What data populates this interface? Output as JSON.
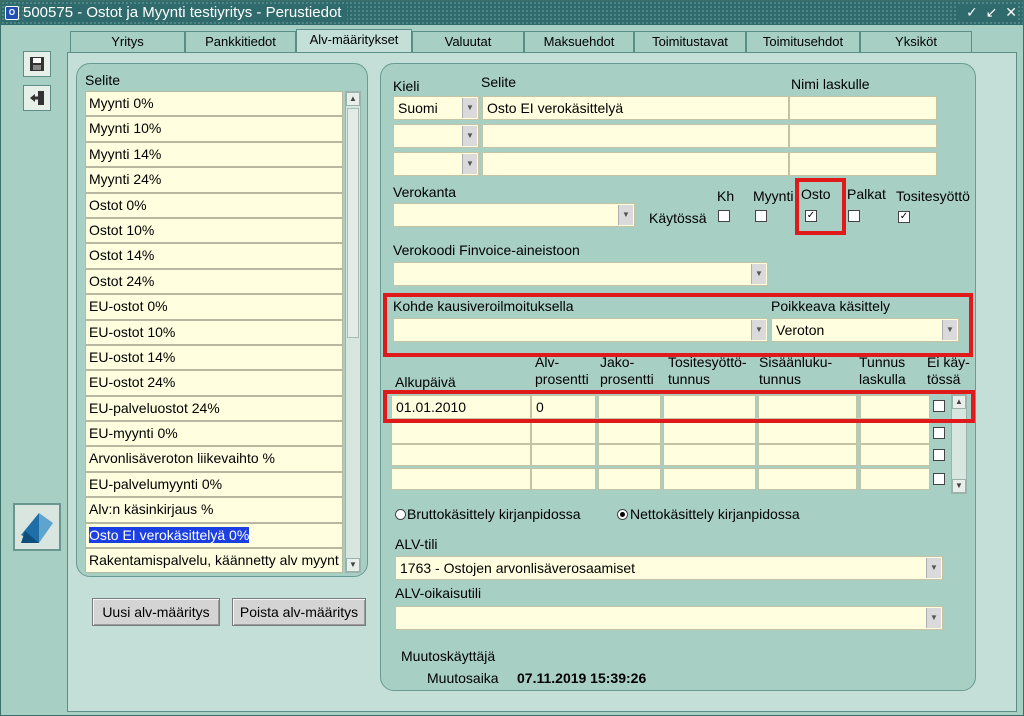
{
  "window": {
    "title": "500575 - Ostot ja Myynti testiyritys - Perustiedot",
    "controls": [
      "✓",
      "↙",
      "✕"
    ]
  },
  "tabs": [
    "Yritys",
    "Pankkitiedot",
    "Alv-määritykset",
    "Valuutat",
    "Maksuehdot",
    "Toimitustavat",
    "Toimitusehdot",
    "Yksiköt"
  ],
  "active_tab": "Alv-määritykset",
  "left_panel": {
    "header": "Selite",
    "items": [
      "Myynti 0%",
      "Myynti 10%",
      "Myynti 14%",
      "Myynti 24%",
      "Ostot 0%",
      "Ostot 10%",
      "Ostot 14%",
      "Ostot 24%",
      "EU-ostot 0%",
      "EU-ostot 10%",
      "EU-ostot 14%",
      "EU-ostot 24%",
      "EU-palveluostot 24%",
      "EU-myynti 0%",
      "Arvonlisäveroton liikevaihto %",
      "EU-palvelumyynti 0%",
      "Alv:n käsinkirjaus %",
      "Osto EI verokäsittelyä 0%",
      "Rakentamispalvelu, käännetty alv myynt"
    ],
    "selected_index": 17
  },
  "buttons": {
    "new": "Uusi alv-määritys",
    "delete": "Poista alv-määritys"
  },
  "form": {
    "hdr_kieli": "Kieli",
    "hdr_selite": "Selite",
    "hdr_nimi": "Nimi laskulle",
    "row1": {
      "kieli": "Suomi",
      "selite": "Osto EI verokäsittelyä",
      "nimi": ""
    },
    "verokanta_label": "Verokanta",
    "kaytossa_label": "Käytössä",
    "flags": [
      {
        "label": "Kh",
        "checked": false
      },
      {
        "label": "Myynti",
        "checked": false
      },
      {
        "label": "Osto",
        "checked": true
      },
      {
        "label": "Palkat",
        "checked": false
      },
      {
        "label": "Tositesyöttö",
        "checked": true
      }
    ],
    "finvoice_label": "Verokoodi Finvoice-aineistoon",
    "kohde_label": "Kohde kausiveroilmoituksella",
    "poikkeava_label": "Poikkeava käsittely",
    "poikkeava_value": "Veroton",
    "grid_headers": {
      "alkupaiva": "Alkupäivä",
      "alv": [
        "Alv-",
        "prosentti"
      ],
      "jako": [
        "Jako-",
        "prosentti"
      ],
      "tosite": [
        "Tositesyöttö-",
        "tunnus"
      ],
      "sisaan": [
        "Sisäänluku-",
        "tunnus"
      ],
      "tunnus": [
        "Tunnus",
        "laskulla"
      ],
      "ei": [
        "Ei käy-",
        "tössä"
      ]
    },
    "grid_row1": {
      "alkupaiva": "01.01.2010",
      "alv": "0"
    },
    "radio_brutto": "Bruttokäsittely kirjanpidossa",
    "radio_netto": "Nettokäsittely kirjanpidossa",
    "netto_selected": true,
    "alv_tili_label": "ALV-tili",
    "alv_tili_value": "1763 - Ostojen arvonlisäverosaamiset",
    "alv_oikaisu_label": "ALV-oikaisutili",
    "muutoskayttaja_label": "Muutoskäyttäjä",
    "muutosaika_label": "Muutosaika",
    "muutosaika_value": "07.11.2019 15:39:26"
  },
  "colors": {
    "panel": "#a7cfc4",
    "field": "#ffffe0",
    "selection": "#1b3fe0",
    "highlight": "#e01a1a"
  }
}
